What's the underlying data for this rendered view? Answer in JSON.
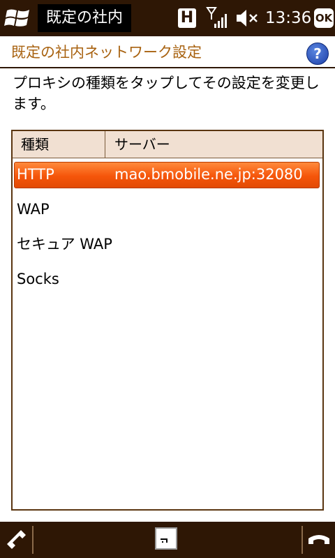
{
  "statusbar": {
    "app_title": "既定の社内",
    "network_badge": "H",
    "time": "13:36",
    "ok_label": "OK",
    "icons": [
      "windows-start-icon",
      "h-network-icon",
      "signal-icon",
      "speaker-muted-icon"
    ]
  },
  "header": {
    "title": "既定の社内ネットワーク設定",
    "help_label": "?"
  },
  "instruction": "プロキシの種類をタップしてその設定を変更します。",
  "table": {
    "columns": [
      "種類",
      "サーバー"
    ],
    "rows": [
      {
        "type": "HTTP",
        "server": "mao.bmobile.ne.jp:32080",
        "selected": true
      },
      {
        "type": "WAP",
        "server": ""
      },
      {
        "type": "セキュア WAP",
        "server": ""
      },
      {
        "type": "Socks",
        "server": ""
      }
    ]
  },
  "softbar": {
    "icons": [
      "call-icon",
      "keyboard-icon",
      "end-call-icon"
    ]
  },
  "colors": {
    "bar": "#2e1705",
    "title_text": "#a86210",
    "selection": "#f5550a",
    "header_bg": "#f1e0d2"
  }
}
